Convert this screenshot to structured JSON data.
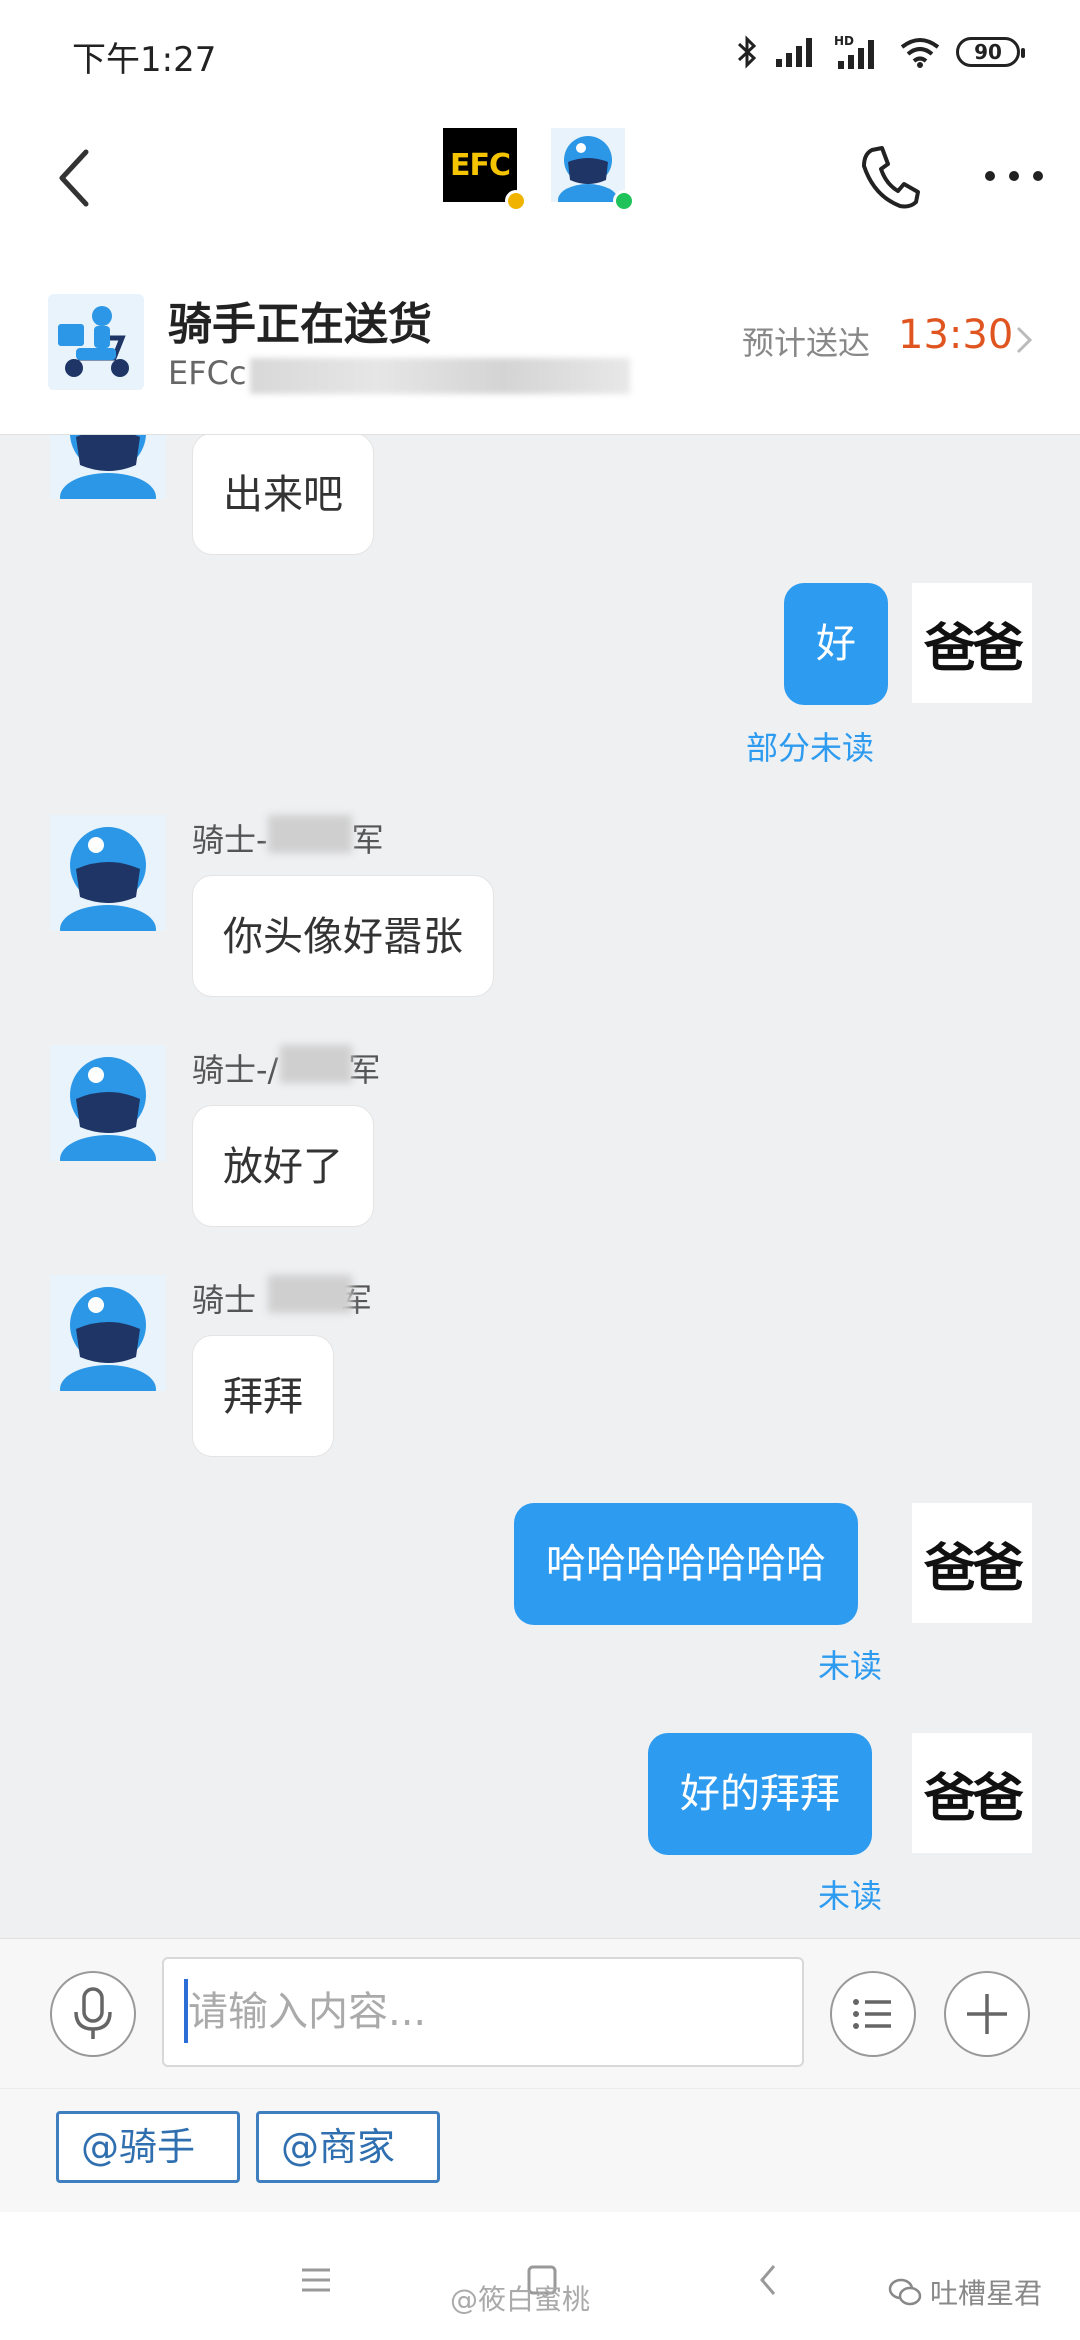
{
  "status_bar": {
    "time": "下午1:27",
    "battery": "90",
    "network": "HD"
  },
  "order": {
    "title": "骑手正在送货",
    "subtitle": "EFCc",
    "eta_label": "预计送达",
    "eta_time": "13:30"
  },
  "group": {
    "avatar_1_text": "EFC"
  },
  "messages": [
    {
      "direction": "in",
      "text": "出来吧"
    },
    {
      "direction": "out",
      "text": "好",
      "avatar_text": "爸爸",
      "status": "部分未读"
    },
    {
      "direction": "in",
      "sender_prefix": "骑士-",
      "sender_suffix": "军",
      "text": "你头像好嚣张"
    },
    {
      "direction": "in",
      "sender_prefix": "骑士-/",
      "sender_suffix": "军",
      "text": "放好了"
    },
    {
      "direction": "in",
      "sender_prefix": "骑士",
      "sender_suffix": "军",
      "text": "拜拜"
    },
    {
      "direction": "out",
      "text": "哈哈哈哈哈哈哈",
      "avatar_text": "爸爸",
      "status": "未读"
    },
    {
      "direction": "out",
      "text": "好的拜拜",
      "avatar_text": "爸爸",
      "status": "未读"
    }
  ],
  "input": {
    "placeholder": "请输入内容..."
  },
  "quick_replies": [
    "@骑手",
    "@商家"
  ],
  "footer": {
    "watermark": "@筱白蜜桃",
    "brand": "吐槽星君"
  },
  "colors": {
    "accent": "#2d9bf0",
    "eta": "#e0541f",
    "quick_border": "#3f7fbf"
  }
}
